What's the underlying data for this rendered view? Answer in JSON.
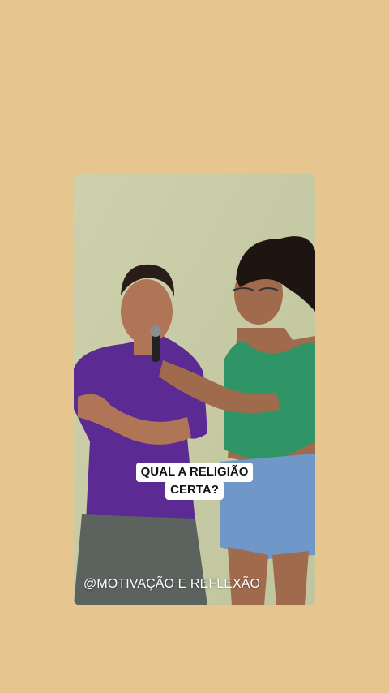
{
  "colors": {
    "background": "#e6c58f",
    "wall": "#c9cca6",
    "man_shirt": "#5b2a93",
    "woman_top": "#2f9566",
    "shorts": "#6f98c8"
  },
  "video": {
    "caption_line1": "QUAL A RELIGIÃO",
    "caption_line2": "CERTA?",
    "watermark": "@MOTIVAÇÃO E REFLEXÃO"
  }
}
